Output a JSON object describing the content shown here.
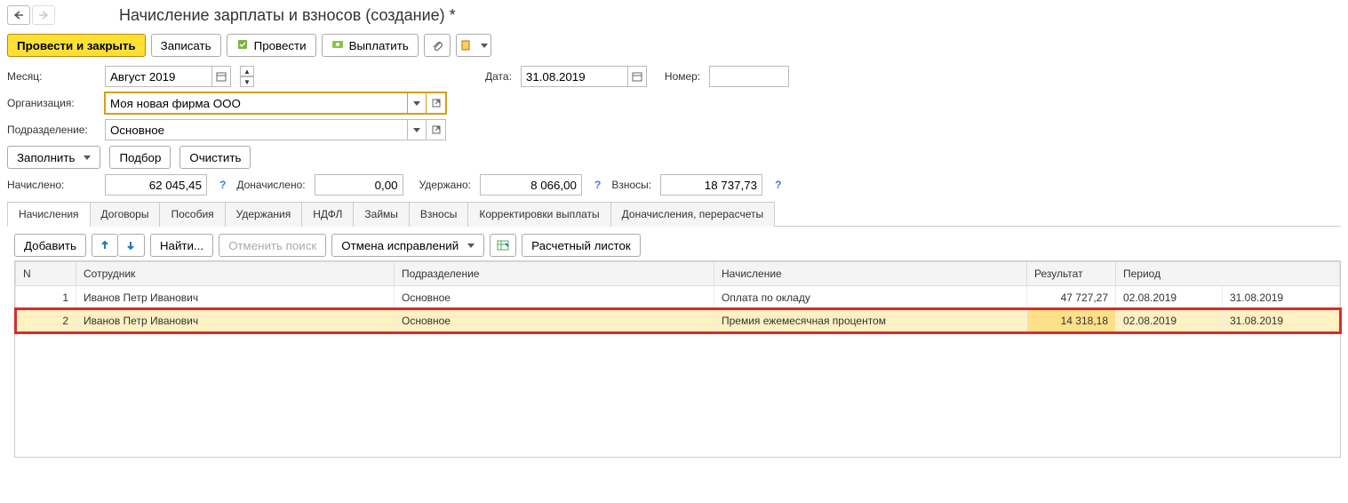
{
  "title": "Начисление зарплаты и взносов (создание) *",
  "toolbar": {
    "post_and_close": "Провести и закрыть",
    "save": "Записать",
    "post": "Провести",
    "pay": "Выплатить"
  },
  "form": {
    "month_label": "Месяц:",
    "month_value": "Август 2019",
    "date_label": "Дата:",
    "date_value": "31.08.2019",
    "number_label": "Номер:",
    "number_value": "",
    "org_label": "Организация:",
    "org_value": "Моя новая фирма ООО",
    "dep_label": "Подразделение:",
    "dep_value": "Основное"
  },
  "actions": {
    "fill": "Заполнить",
    "pick": "Подбор",
    "clear": "Очистить"
  },
  "totals": {
    "accrued_label": "Начислено:",
    "accrued_value": "62 045,45",
    "additional_label": "Доначислено:",
    "additional_value": "0,00",
    "withheld_label": "Удержано:",
    "withheld_value": "8 066,00",
    "contrib_label": "Взносы:",
    "contrib_value": "18 737,73"
  },
  "tabs": [
    "Начисления",
    "Договоры",
    "Пособия",
    "Удержания",
    "НДФЛ",
    "Займы",
    "Взносы",
    "Корректировки выплаты",
    "Доначисления, перерасчеты"
  ],
  "table_toolbar": {
    "add": "Добавить",
    "find": "Найти...",
    "cancel_search": "Отменить поиск",
    "cancel_corrections": "Отмена исправлений",
    "payslip": "Расчетный листок"
  },
  "columns": {
    "n": "N",
    "employee": "Сотрудник",
    "department": "Подразделение",
    "accrual": "Начисление",
    "result": "Результат",
    "period": "Период"
  },
  "rows": [
    {
      "n": "1",
      "employee": "Иванов Петр Иванович",
      "department": "Основное",
      "accrual": "Оплата по окладу",
      "result": "47 727,27",
      "period_from": "02.08.2019",
      "period_to": "31.08.2019"
    },
    {
      "n": "2",
      "employee": "Иванов Петр Иванович",
      "department": "Основное",
      "accrual": "Премия ежемесячная процентом",
      "result": "14 318,18",
      "period_from": "02.08.2019",
      "period_to": "31.08.2019"
    }
  ]
}
